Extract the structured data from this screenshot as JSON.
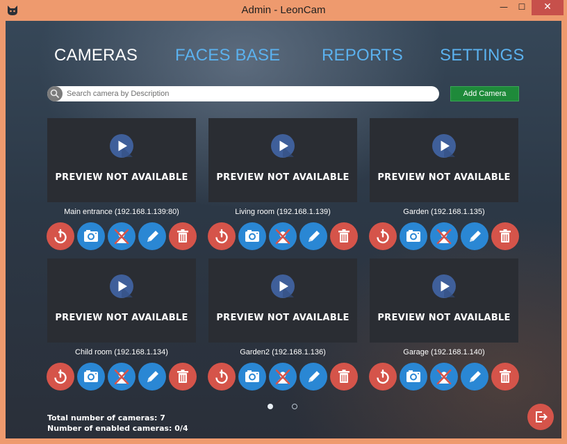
{
  "window": {
    "title": "Admin - LeonCam",
    "minimize_glyph": "—",
    "maximize_glyph": "☐",
    "close_glyph": "✕"
  },
  "nav": {
    "tabs": [
      {
        "label": "CAMERAS",
        "active": true
      },
      {
        "label": "FACES BASE",
        "active": false
      },
      {
        "label": "REPORTS",
        "active": false
      },
      {
        "label": "SETTINGS",
        "active": false
      }
    ]
  },
  "search": {
    "placeholder": "Search camera by Description",
    "value": ""
  },
  "add_camera_label": "Add Camera",
  "cameras": [
    {
      "preview_text": "PREVIEW NOT AVAILABLE",
      "label": "Main entrance (192.168.1.139:80)"
    },
    {
      "preview_text": "PREVIEW NOT AVAILABLE",
      "label": "Living room (192.168.1.139)"
    },
    {
      "preview_text": "PREVIEW NOT AVAILABLE",
      "label": "Garden (192.168.1.135)"
    },
    {
      "preview_text": "PREVIEW NOT AVAILABLE",
      "label": "Child room (192.168.1.134)"
    },
    {
      "preview_text": "PREVIEW NOT AVAILABLE",
      "label": "Garden2 (192.168.1.136)"
    },
    {
      "preview_text": "PREVIEW NOT AVAILABLE",
      "label": "Garage (192.168.1.140)"
    }
  ],
  "camera_actions": [
    {
      "icon": "power-icon",
      "color": "#d5544a"
    },
    {
      "icon": "camera-icon",
      "color": "#2a87d4"
    },
    {
      "icon": "face-recognition-off-icon",
      "color": "#2a87d4"
    },
    {
      "icon": "pencil-icon",
      "color": "#2a87d4"
    },
    {
      "icon": "trash-icon",
      "color": "#d5544a"
    }
  ],
  "pagination": {
    "pages": 2,
    "current": 1
  },
  "stats": {
    "total": "Total number of cameras: 7",
    "enabled": "Number of enabled cameras: 0/4"
  },
  "colors": {
    "accent_blue": "#5bb1ee",
    "add_button_green": "#1e8a3a",
    "danger_red": "#d5544a",
    "action_blue": "#2a87d4",
    "window_frame": "#ee9a6e"
  }
}
